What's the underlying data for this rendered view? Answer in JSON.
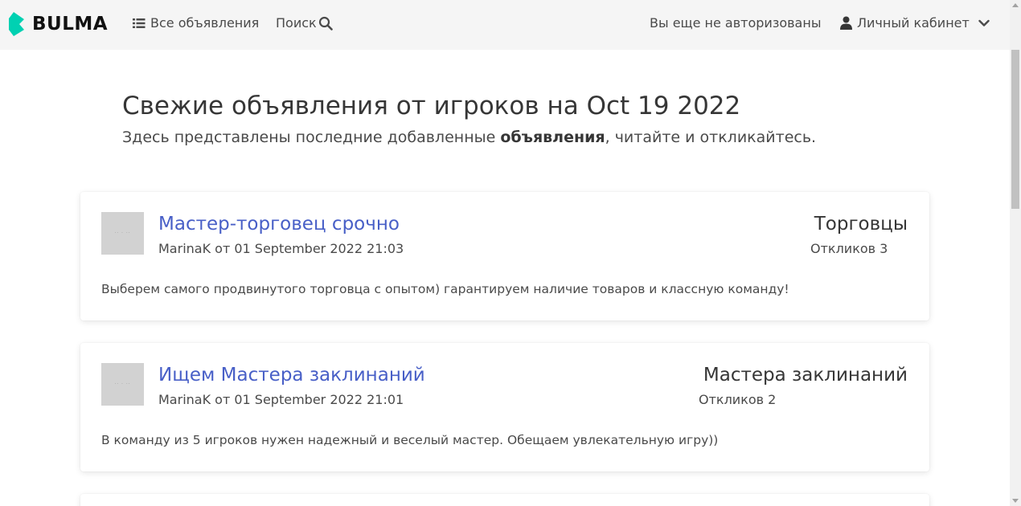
{
  "navbar": {
    "brand": "BULMA",
    "all_ads": "Все объявления",
    "search": "Поиск",
    "auth_status": "Вы еще не авторизованы",
    "account": "Личный кабинет"
  },
  "hero": {
    "title": "Свежие объявления от игроков на Oct 19 2022",
    "subtitle_pre": "Здесь представлены последние добавленные ",
    "subtitle_bold": "объявления",
    "subtitle_post": ", читайте и откликайтесь."
  },
  "ads": [
    {
      "title": "Мастер-торговец срочно",
      "meta": "MarinaK от 01 September 2022 21:03",
      "category": "Торговцы",
      "replies": "Откликов 3",
      "text": "Выберем самого продвинутого торговца с опытом) гарантируем наличие товаров и классную команду!"
    },
    {
      "title": "Ищем Мастера заклинаний",
      "meta": "MarinaK от 01 September 2022 21:01",
      "category": "Мастера заклинаний",
      "replies": "Откликов 2",
      "text": "В команду из 5 игроков нужен надежный и веселый мастер. Обещаем увлекательную игру))"
    }
  ],
  "colors": {
    "brand": "#00d1b2",
    "link": "#485fc7",
    "navbar_bg": "#f5f5f5"
  }
}
